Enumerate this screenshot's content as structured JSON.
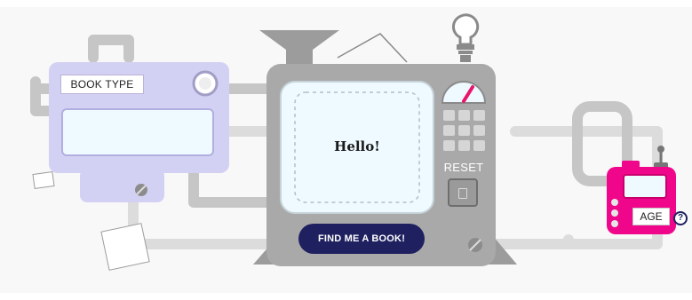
{
  "book_type": {
    "label": "BOOK TYPE",
    "value": "",
    "placeholder": ""
  },
  "screen": {
    "greeting": "Hello!"
  },
  "reset": {
    "label": "RESET"
  },
  "find_button": {
    "label": "FIND ME A BOOK!"
  },
  "age": {
    "label": "AGE",
    "value": "",
    "placeholder": ""
  },
  "help": {
    "symbol": "?"
  },
  "colors": {
    "background": "#f8f8f8",
    "pipe": "#dcdcdc",
    "machine_gray": "#a9a9a9",
    "book_machine": "#d3d1f3",
    "screen": "#eefaff",
    "button_navy": "#1f2060",
    "age_machine": "#f0068a",
    "gauge_needle": "#e8156b"
  },
  "icons": [
    "lightbulb-icon",
    "funnel-icon",
    "gauge-icon",
    "screw-icon",
    "help-icon",
    "antenna-icon",
    "handle-icon"
  ]
}
